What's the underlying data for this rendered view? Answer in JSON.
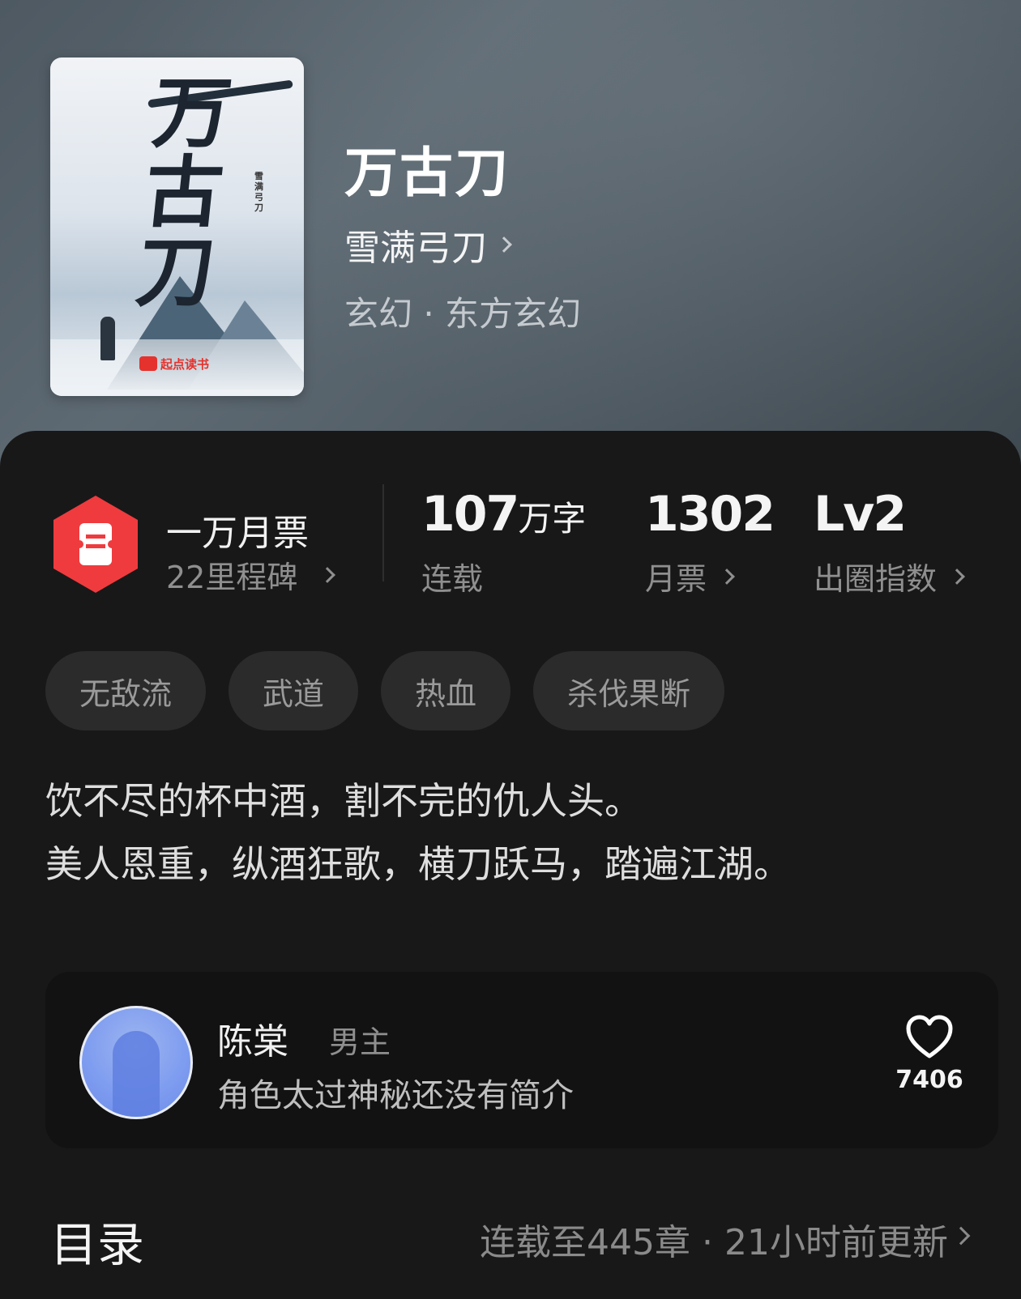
{
  "book": {
    "title": "万古刀",
    "author": "雪满弓刀",
    "genre": "玄幻 · 东方玄幻",
    "cover": {
      "calligraphy": "万古刀",
      "vertical_text": "雪满弓刀",
      "logo_text": "起点读书"
    }
  },
  "stats": {
    "milestone": {
      "title": "一万月票",
      "subtitle": "22里程碑"
    },
    "words": {
      "value": "107",
      "unit": "万字",
      "label": "连载"
    },
    "tickets": {
      "value": "1302",
      "label": "月票"
    },
    "influence": {
      "value": "Lv2",
      "label": "出圈指数"
    }
  },
  "tags": [
    "无敌流",
    "武道",
    "热血",
    "杀伐果断"
  ],
  "description": {
    "line1": "饮不尽的杯中酒，割不完的仇人头。",
    "line2": "美人恩重，纵酒狂歌，横刀跃马，踏遍江湖。"
  },
  "character": {
    "name": "陈棠",
    "role": "男主",
    "intro": "角色太过神秘还没有简介",
    "likes": "7406"
  },
  "toc": {
    "title": "目录",
    "info": "连载至445章 · 21小时前更新"
  },
  "colors": {
    "badge": "#ef3b3e",
    "panel": "#181818",
    "tag_bg": "#2b2b2b"
  }
}
